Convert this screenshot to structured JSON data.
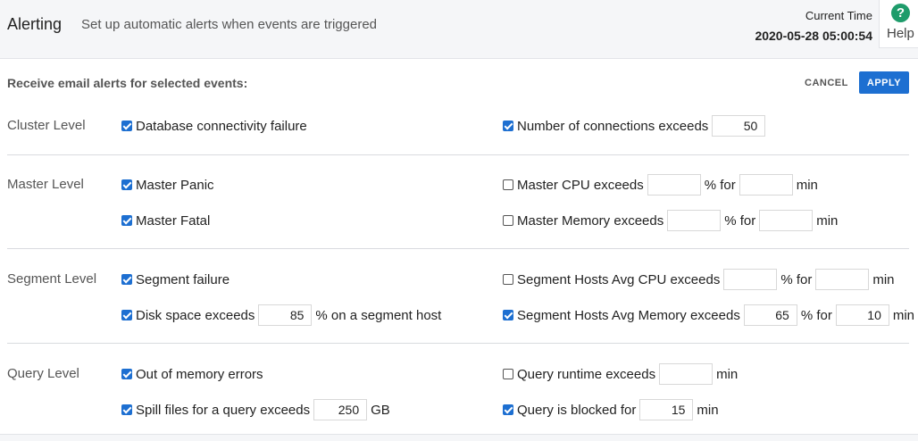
{
  "header": {
    "title": "Alerting",
    "subtitle": "Set up automatic alerts when events are triggered",
    "current_time_label": "Current Time",
    "current_time_value": "2020-05-28 05:00:54",
    "help_icon_glyph": "?",
    "help_label": "Help"
  },
  "form": {
    "heading": "Receive email alerts for selected events:",
    "cancel_label": "CANCEL",
    "apply_label": "APPLY"
  },
  "levels": {
    "cluster": "Cluster Level",
    "master": "Master Level",
    "segment": "Segment Level",
    "query": "Query Level"
  },
  "alerts": {
    "db_connectivity": {
      "checked": true,
      "label": "Database connectivity failure"
    },
    "num_connections": {
      "checked": true,
      "label": "Number of connections exceeds",
      "value": "50"
    },
    "master_panic": {
      "checked": true,
      "label": "Master Panic"
    },
    "master_fatal": {
      "checked": true,
      "label": "Master Fatal"
    },
    "master_cpu": {
      "checked": false,
      "label": "Master CPU exceeds",
      "percent": "",
      "mid": "% for",
      "minutes": "",
      "unit": "min"
    },
    "master_memory": {
      "checked": false,
      "label": "Master Memory exceeds",
      "percent": "",
      "mid": "% for",
      "minutes": "",
      "unit": "min"
    },
    "segment_failure": {
      "checked": true,
      "label": "Segment failure"
    },
    "disk_space": {
      "checked": true,
      "label": "Disk space exceeds",
      "value": "85",
      "suffix": "% on a segment host"
    },
    "seg_cpu": {
      "checked": false,
      "label": "Segment Hosts Avg CPU exceeds",
      "percent": "",
      "mid": "% for",
      "minutes": "",
      "unit": "min"
    },
    "seg_memory": {
      "checked": true,
      "label": "Segment Hosts Avg Memory exceeds",
      "percent": "65",
      "mid": "% for",
      "minutes": "10",
      "unit": "min"
    },
    "out_of_memory": {
      "checked": true,
      "label": "Out of memory errors"
    },
    "spill_files": {
      "checked": true,
      "label": "Spill files for a query exceeds",
      "value": "250",
      "unit": "GB"
    },
    "query_runtime": {
      "checked": false,
      "label": "Query runtime exceeds",
      "value": "",
      "unit": "min"
    },
    "query_blocked": {
      "checked": true,
      "label": "Query is blocked for",
      "value": "15",
      "unit": "min"
    }
  },
  "colors": {
    "accent": "#1d6fd1",
    "help_green": "#1e9c6b"
  }
}
